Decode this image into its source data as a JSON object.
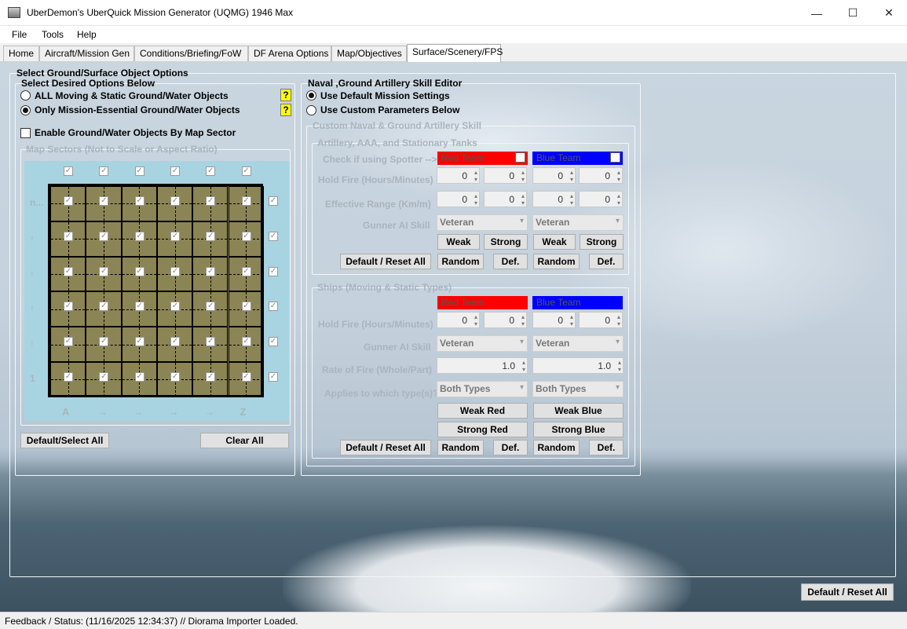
{
  "window": {
    "title": "UberDemon's UberQuick Mission Generator (UQMG) 1946 Max",
    "min_glyph": "—",
    "max_glyph": "☐",
    "close_glyph": "✕"
  },
  "menu": [
    "File",
    "Tools",
    "Help"
  ],
  "tabs": [
    "Home",
    "Aircraft/Mission Gen",
    "Conditions/Briefing/FoW",
    "DF Arena Options",
    "Map/Objectives",
    "Surface/Scenery/FPS"
  ],
  "active_tab": "Surface/Scenery/FPS",
  "left": {
    "group_title": "Select Ground/Surface Object Options",
    "desired_title": "Select Desired Options Below",
    "option_all": "ALL Moving & Static Ground/Water Objects",
    "option_essential": "Only Mission-Essential Ground/Water Objects",
    "help_glyph": "?",
    "enable_sector_label": "Enable Ground/Water Objects By Map Sector",
    "map_sectors_title": "Map Sectors (Not to Scale or Aspect Ratio)",
    "row_labels": [
      "n...",
      "↑",
      "↑",
      "↑",
      "↑",
      "1"
    ],
    "col_labels": [
      "A",
      "→",
      "→",
      "→",
      "→",
      "Z"
    ],
    "check_glyph": "✓",
    "default_select_all": "Default/Select All",
    "clear_all": "Clear All"
  },
  "right": {
    "editor_title": "Naval ,Ground Artillery Skill Editor",
    "use_default": "Use Default Mission Settings",
    "use_custom": "Use Custom Parameters Below",
    "custom_title": "Custom Naval & Ground Artillery Skill",
    "artillery": {
      "title": "Artillery, AAA, and Stationary Tanks",
      "spotter_label": "Check if using Spotter -->",
      "red_team": "Red Team",
      "blue_team": "Blue Team",
      "hold_fire_label": "Hold Fire (Hours/Minutes)",
      "hold_fire_values": [
        "0",
        "0",
        "0",
        "0"
      ],
      "range_label": "Effective Range (Km/m)",
      "range_values": [
        "0",
        "0",
        "0",
        "0"
      ],
      "skill_label": "Gunner AI Skill",
      "red_skill": "Veteran",
      "blue_skill": "Veteran",
      "weak": "Weak",
      "strong": "Strong",
      "reset": "Default / Reset All",
      "random": "Random",
      "def": "Def."
    },
    "ships": {
      "title": "Ships (Moving & Static Types)",
      "red_team": "Red Team",
      "blue_team": "Blue Team",
      "hold_fire_label": "Hold Fire (Hours/Minutes)",
      "hold_fire_values": [
        "0",
        "0",
        "0",
        "0"
      ],
      "skill_label": "Gunner AI Skill",
      "red_skill": "Veteran",
      "blue_skill": "Veteran",
      "rate_label": "Rate of Fire (Whole/Part)",
      "red_rate": "1.0",
      "blue_rate": "1.0",
      "types_label": "Applies to which type(s)?",
      "red_types": "Both Types",
      "blue_types": "Both Types",
      "weak_red": "Weak Red",
      "weak_blue": "Weak Blue",
      "strong_red": "Strong Red",
      "strong_blue": "Strong Blue",
      "reset": "Default / Reset All",
      "random": "Random",
      "def": "Def."
    }
  },
  "global_reset": "Default / Reset All",
  "status": {
    "label": "Feedback / Status:",
    "text": "(11/16/2025 12:34:37) // Diorama Importer Loaded."
  },
  "colors": {
    "red_team": "#ff0000",
    "blue_team": "#0000ff",
    "help": "#ffff00",
    "map_bg": "#a8d4e2",
    "map_cell": "#8b8454"
  }
}
